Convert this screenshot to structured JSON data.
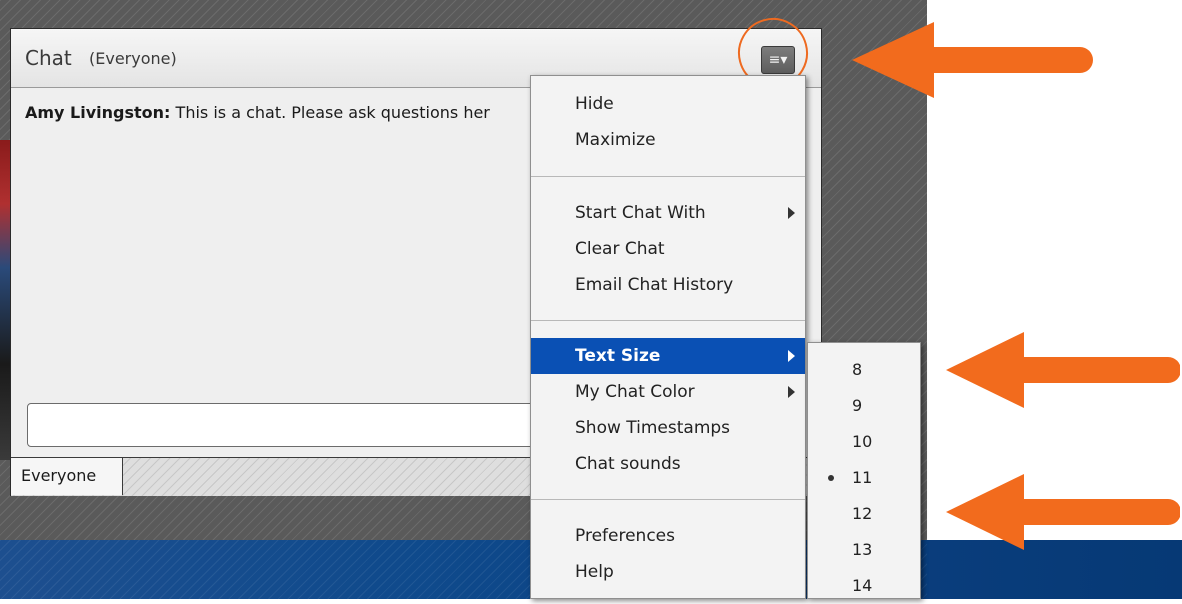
{
  "colors": {
    "accent_orange": "#f26b1d",
    "selection_blue": "#0a50b4",
    "band_blue": "#0b3f7f"
  },
  "chat_pod": {
    "title": "Chat",
    "subtitle": "(Everyone)",
    "menu_button_icon": "menu-lines-icon",
    "message": {
      "author": "Amy Livingston:",
      "text": " This is a chat. Please ask questions her"
    },
    "input": {
      "value": "",
      "placeholder": ""
    },
    "footer_tab": "Everyone"
  },
  "menu": {
    "items": [
      {
        "label": "Hide"
      },
      {
        "label": "Maximize"
      },
      {
        "label": "Start Chat With",
        "submenu": true
      },
      {
        "label": "Clear Chat"
      },
      {
        "label": "Email Chat History"
      },
      {
        "label": "Text Size",
        "submenu": true,
        "highlighted": true
      },
      {
        "label": "My Chat Color",
        "submenu": true
      },
      {
        "label": "Show Timestamps"
      },
      {
        "label": "Chat sounds"
      },
      {
        "label": "Preferences"
      },
      {
        "label": "Help"
      }
    ]
  },
  "text_size_submenu": {
    "options": [
      "8",
      "9",
      "10",
      "11",
      "12",
      "13",
      "14"
    ],
    "selected": "11"
  }
}
